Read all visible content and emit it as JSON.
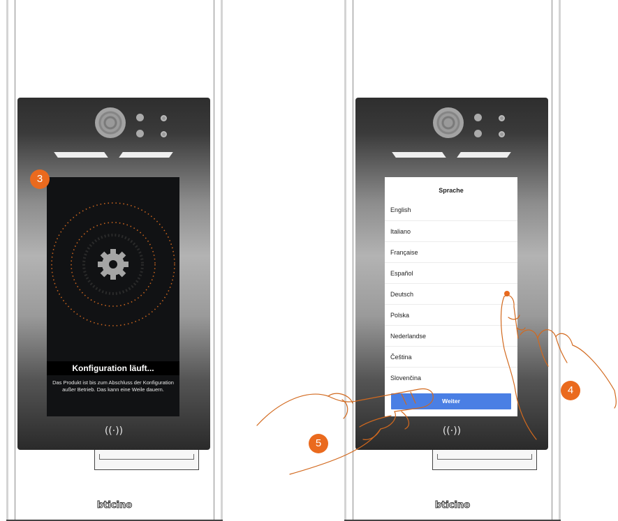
{
  "brand": "bticino",
  "left_panel": {
    "step_badge": "3",
    "config_title": "Konfiguration läuft...",
    "config_message": "Das Produkt ist bis zum Abschluss der Konfiguration außer Betrieb. Das kann eine Weile dauern.",
    "icon": "gear-icon",
    "nfc_glyph": "((·))"
  },
  "right_panel": {
    "title": "Sprache",
    "languages": [
      "English",
      "Italiano",
      "Française",
      "Español",
      "Deutsch",
      "Polska",
      "Nederlandse",
      "Čeština",
      "Slovenčina"
    ],
    "next_button": "Weiter",
    "nfc_glyph": "((·))",
    "step_badges": [
      "4",
      "5"
    ]
  },
  "colors": {
    "accent_orange": "#ea6a1e",
    "button_blue": "#4a7fe4",
    "screen_dark": "#111214"
  }
}
